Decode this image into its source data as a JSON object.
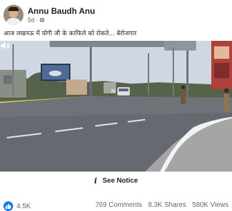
{
  "post": {
    "author": "Annu Baudh Anu",
    "time": "5d",
    "visibility_icon": "globe-icon",
    "caption": "आज लखनऊ में योगी जी के काफिले को रोकते... बेरोजगार"
  },
  "video": {
    "audio_icon": "speaker-icon"
  },
  "notice": {
    "icon": "info-icon",
    "label": "See Notice"
  },
  "footer": {
    "reaction_icon": "like-icon",
    "reaction_count": "4.5K",
    "comments": "769 Comments",
    "shares": "8.3K Shares",
    "views": "580K Views"
  },
  "colors": {
    "brand_blue": "#1877f2",
    "text": "#1c1e21",
    "muted": "#65676b"
  }
}
